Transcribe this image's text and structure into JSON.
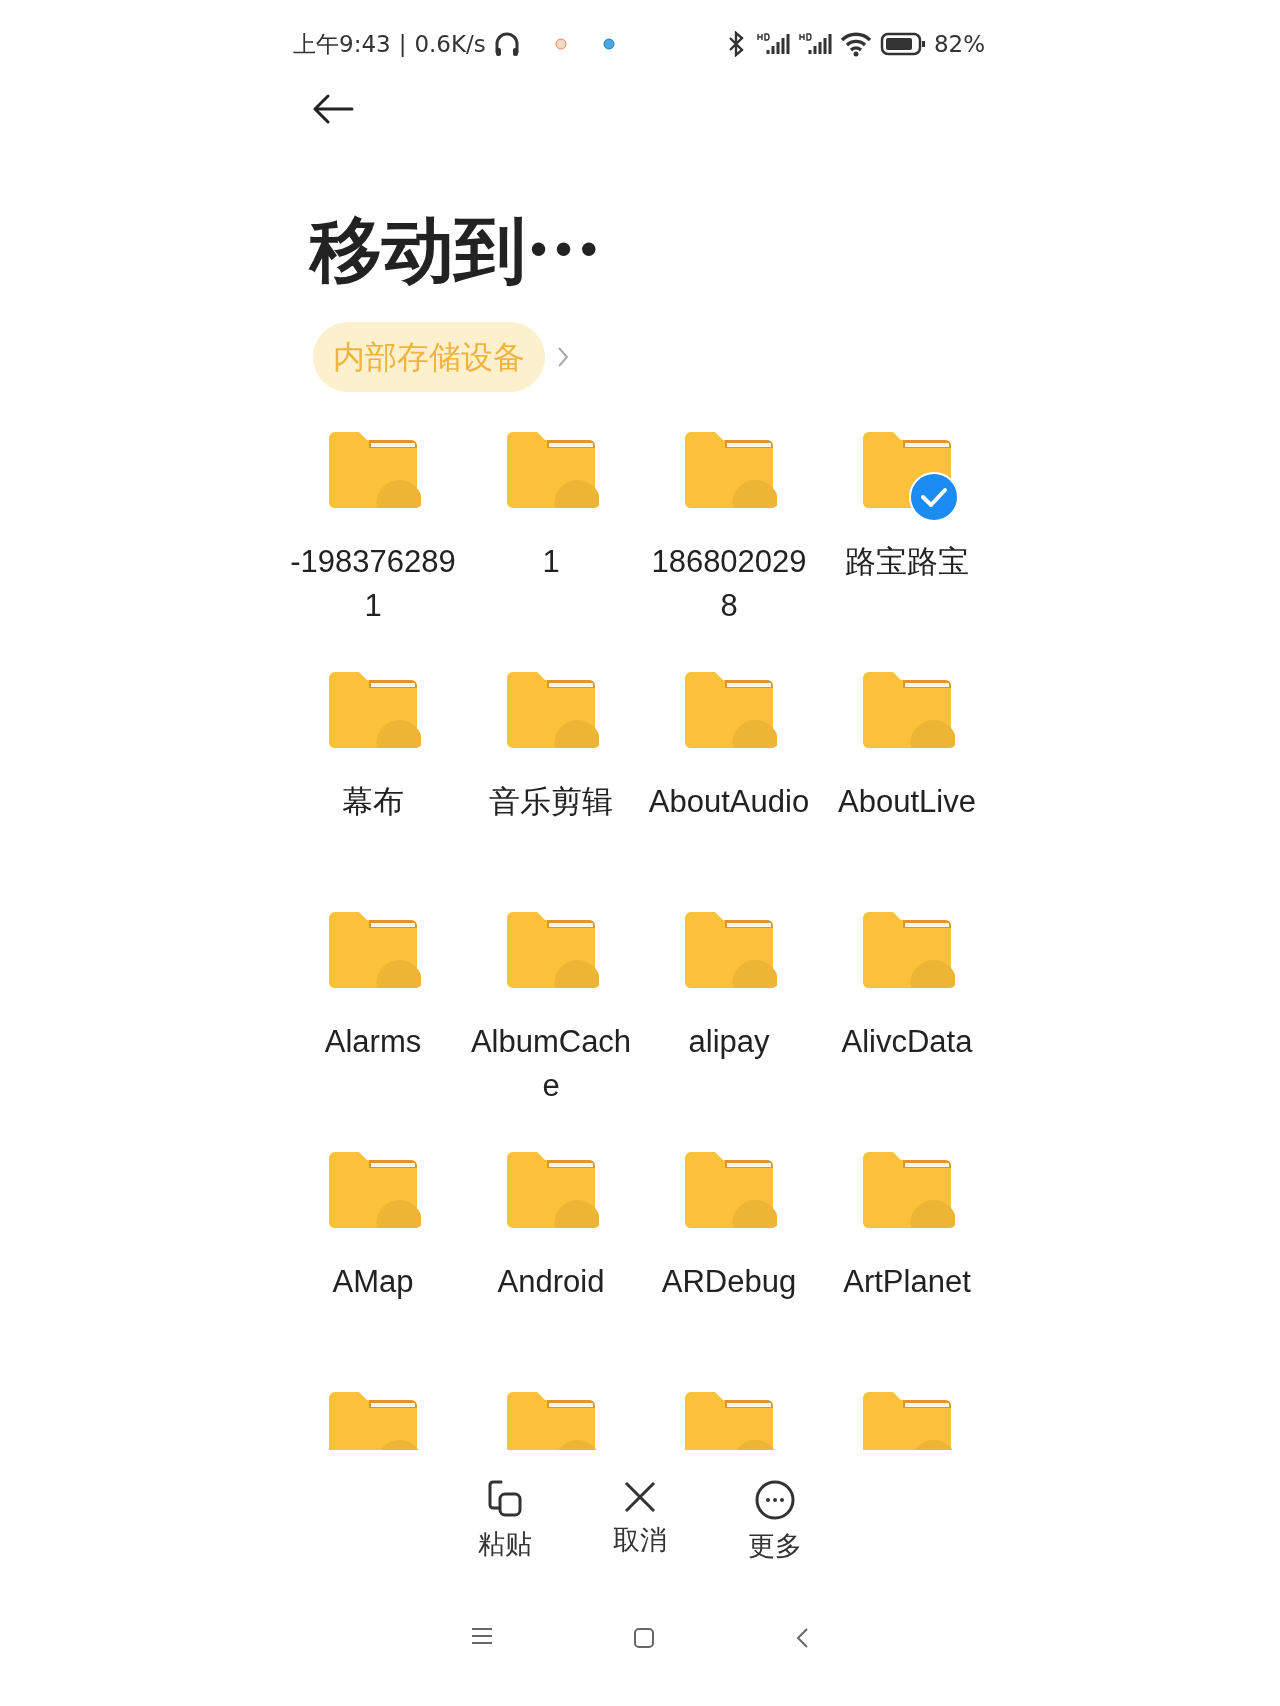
{
  "status_bar": {
    "time": "上午9:43",
    "separator": "|",
    "speed": "0.6K/s",
    "battery": "82%"
  },
  "title": "移动到···",
  "breadcrumb": {
    "label": "内部存储设备"
  },
  "folders": [
    {
      "name": "-1983762891",
      "selected": false
    },
    {
      "name": "1",
      "selected": false
    },
    {
      "name": "1868020298",
      "selected": false
    },
    {
      "name": "路宝路宝",
      "selected": true
    },
    {
      "name": "幕布",
      "selected": false
    },
    {
      "name": "音乐剪辑",
      "selected": false
    },
    {
      "name": "AboutAudio",
      "selected": false
    },
    {
      "name": "AboutLive",
      "selected": false
    },
    {
      "name": "Alarms",
      "selected": false
    },
    {
      "name": "AlbumCache",
      "selected": false
    },
    {
      "name": "alipay",
      "selected": false
    },
    {
      "name": "AlivcData",
      "selected": false
    },
    {
      "name": "AMap",
      "selected": false
    },
    {
      "name": "Android",
      "selected": false
    },
    {
      "name": "ARDebug",
      "selected": false
    },
    {
      "name": "ArtPlanet",
      "selected": false
    },
    {
      "selected": false
    },
    {
      "selected": false
    },
    {
      "selected": false
    },
    {
      "selected": false
    }
  ],
  "actions": [
    {
      "kind": "paste",
      "label": "粘贴"
    },
    {
      "kind": "cancel",
      "label": "取消"
    },
    {
      "kind": "more",
      "label": "更多"
    }
  ]
}
